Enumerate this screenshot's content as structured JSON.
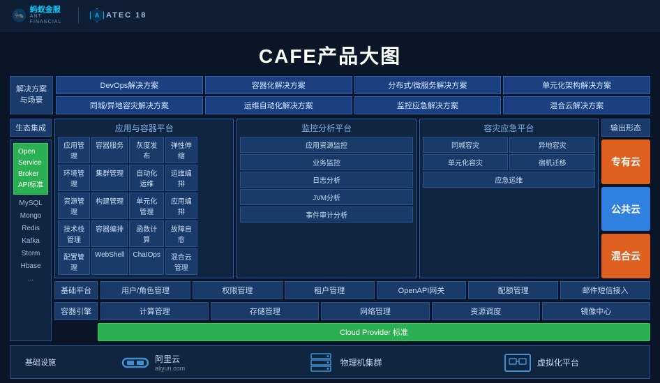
{
  "header": {
    "ant_financial": "蚂蚁金服",
    "atec": "ATEC 18"
  },
  "main_title": "CAFE产品大图",
  "solutions": {
    "label": "解决方案\n与场景",
    "items": [
      "DevOps解决方案",
      "容器化解决方案",
      "分布式/微服务解决方案",
      "单元化架构解决方案",
      "同城/异地容灾解决方案",
      "运维自动化解决方案",
      "监控应急解决方案",
      "混合云解决方案"
    ]
  },
  "ecology": {
    "label": "生态集成",
    "open_service": {
      "line1": "Open",
      "line2": "Service",
      "line3": "Broker",
      "line4": "API标准"
    },
    "tech_items": [
      "MySQL",
      "Mongo",
      "Redis",
      "Kafka",
      "Storm",
      "Hbase",
      "..."
    ]
  },
  "app_container_platform": {
    "title": "应用与容器平台",
    "cells": [
      "应用管理",
      "容器服务",
      "灰度发布",
      "弹性伸缩",
      "—",
      "环境管理",
      "集群管理",
      "自动化运维",
      "运维编排",
      "—",
      "资源管理",
      "构建管理",
      "单元化管理",
      "应用编排",
      "—",
      "技术栈管理",
      "容器编排",
      "函数计算",
      "故障自愈",
      "—",
      "配置管理",
      "WebShell",
      "ChatOps",
      "混合云管理",
      "—"
    ]
  },
  "monitor_platform": {
    "title": "监控分析平台",
    "cells": [
      "应用资源监控",
      "—",
      "业务监控",
      "—",
      "日志分析",
      "—",
      "JVM分析",
      "—",
      "事件审计分析",
      "—"
    ]
  },
  "disaster_platform": {
    "title": "容灾应急平台",
    "cells": [
      "同城容灾",
      "异地容灾",
      "单元化容灾",
      "宿机迁移",
      "应急运维",
      "—"
    ]
  },
  "output_forms": {
    "label": "输出形态",
    "items": [
      "专有云",
      "公共云",
      "混合云"
    ]
  },
  "base_platform": {
    "label": "基础平台",
    "items": [
      "用户/角色管理",
      "权限管理",
      "租户管理",
      "OpenAPI网关",
      "配额管理",
      "邮件短信接入"
    ]
  },
  "container_engine": {
    "label": "容器引擎",
    "items": [
      "计算管理",
      "存储管理",
      "网络管理",
      "资源调度",
      "镜像中心"
    ],
    "cloud_provider": "Cloud Provider 标准"
  },
  "infrastructure": {
    "label": "基础设施",
    "items": [
      {
        "icon": "aliyun",
        "name": "阿里云",
        "sub": "aliyun.com"
      },
      {
        "icon": "server",
        "name": "物理机集群",
        "sub": ""
      },
      {
        "icon": "vm",
        "name": "虚拟化平台",
        "sub": ""
      }
    ]
  }
}
